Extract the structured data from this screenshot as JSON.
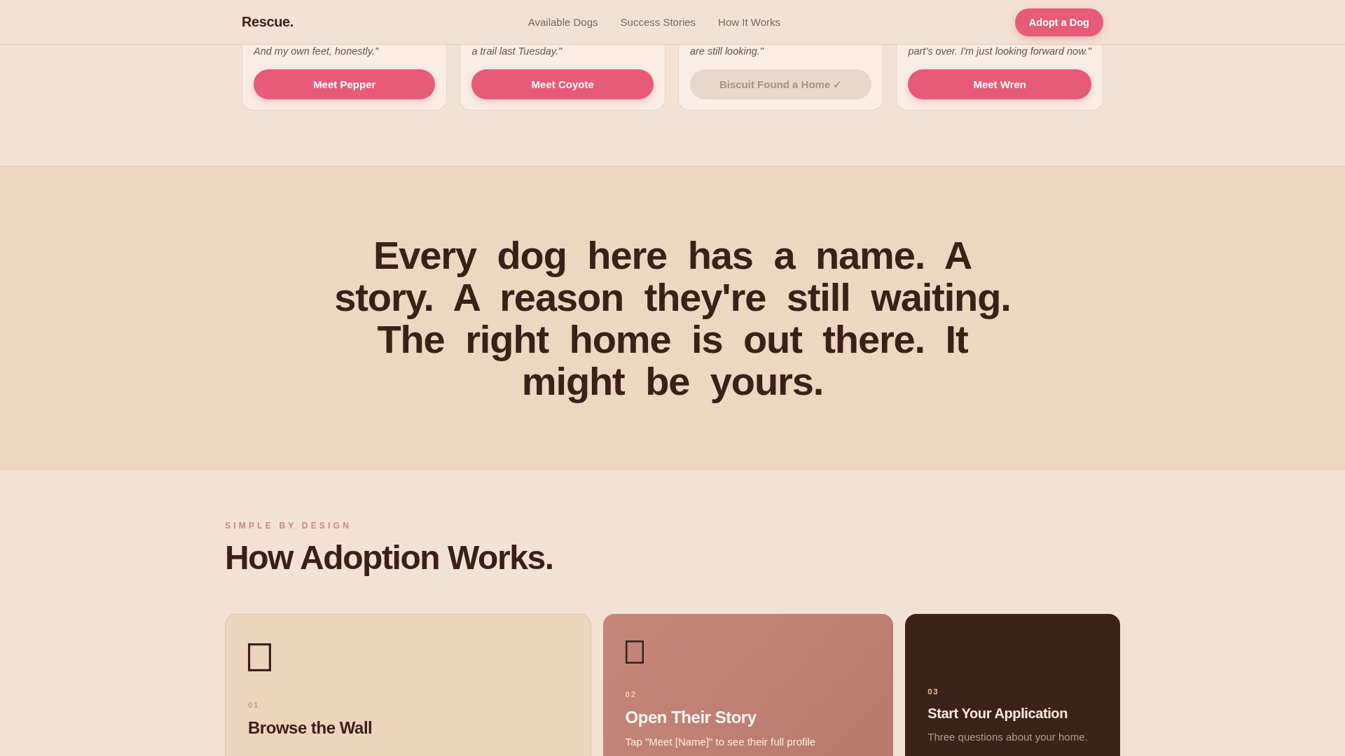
{
  "nav": {
    "logo": "Rescue.",
    "links": [
      {
        "label": "Available Dogs"
      },
      {
        "label": "Success Stories"
      },
      {
        "label": "How It Works"
      }
    ],
    "cta": "Adopt a Dog"
  },
  "dog_cards": [
    {
      "quote": "And my own feet, honestly.\"",
      "button": "Meet Pepper",
      "disabled": false
    },
    {
      "quote": "a trail last Tuesday.\"",
      "button": "Meet Coyote",
      "disabled": false
    },
    {
      "quote": "are still looking.\"",
      "button": "Biscuit Found a Home ✓",
      "disabled": true
    },
    {
      "quote": "part's over. I'm just looking forward now.\"",
      "button": "Meet Wren",
      "disabled": false
    }
  ],
  "manifesto": {
    "text": "Every dog here has a name. A story. A reason they're still waiting. The right home is out there. It might be yours."
  },
  "how_it_works": {
    "eyebrow": "SIMPLE BY DESIGN",
    "heading": "How Adoption Works.",
    "steps": [
      {
        "kind": "light",
        "icon": true,
        "number": "01",
        "title": "Browse the Wall"
      },
      {
        "kind": "accent",
        "icon": true,
        "number": "02",
        "title": "Open Their Story",
        "description": "Tap \"Meet [Name]\" to see their full profile"
      },
      {
        "kind": "dark",
        "icon": false,
        "number": "03",
        "title": "Start Your Application",
        "description": "Three questions about your home."
      }
    ]
  }
}
